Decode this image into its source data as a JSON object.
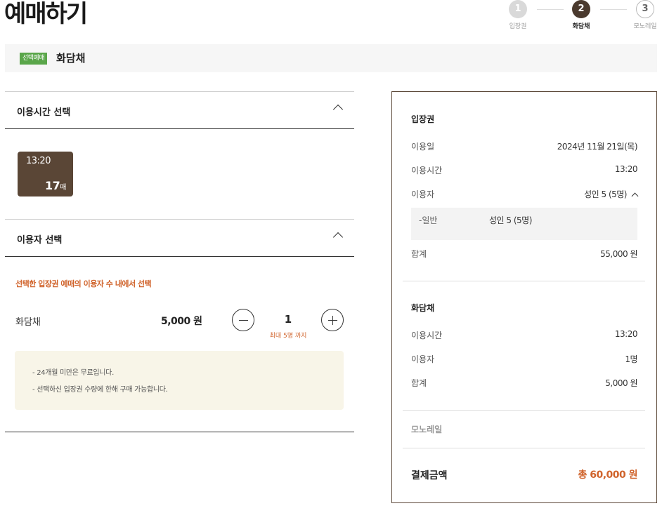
{
  "page_title": "예매하기",
  "steps": [
    {
      "num": "1",
      "label": "입장권"
    },
    {
      "num": "2",
      "label": "화담채"
    },
    {
      "num": "3",
      "label": "모노레일"
    }
  ],
  "selected": {
    "badge": "선택예매",
    "name": "화담채"
  },
  "time_section": {
    "title": "이용시간 선택",
    "slot": {
      "time": "13:20",
      "count": "17",
      "unit": "매"
    }
  },
  "user_section": {
    "title": "이용자 선택",
    "notice": "선택한 입장권 예매의 이용자 수 내에서 선택",
    "row": {
      "name": "화담채",
      "price": "5,000 원",
      "qty": "1",
      "max": "최대 5명 까지"
    },
    "info": [
      "24개월 미만은 무료입니다.",
      "선택하신 입장권 수량에 한해 구매 가능합니다."
    ]
  },
  "summary": {
    "ticket": {
      "title": "입장권",
      "date_label": "이용일",
      "date_value": "2024년 11월 21일(목)",
      "time_label": "이용시간",
      "time_value": "13:20",
      "user_label": "이용자",
      "user_value": "성인 5 (5명)",
      "detail_label": "-일반",
      "detail_value": "성인 5 (5명)",
      "sum_label": "합계",
      "sum_value": "55,000 원"
    },
    "hwadam": {
      "title": "화담채",
      "time_label": "이용시간",
      "time_value": "13:20",
      "user_label": "이용자",
      "user_value": "1명",
      "sum_label": "합계",
      "sum_value": "5,000 원"
    },
    "monorail": {
      "title": "모노레일"
    },
    "total": {
      "label": "결제금액",
      "value": "총 60,000 원"
    }
  }
}
